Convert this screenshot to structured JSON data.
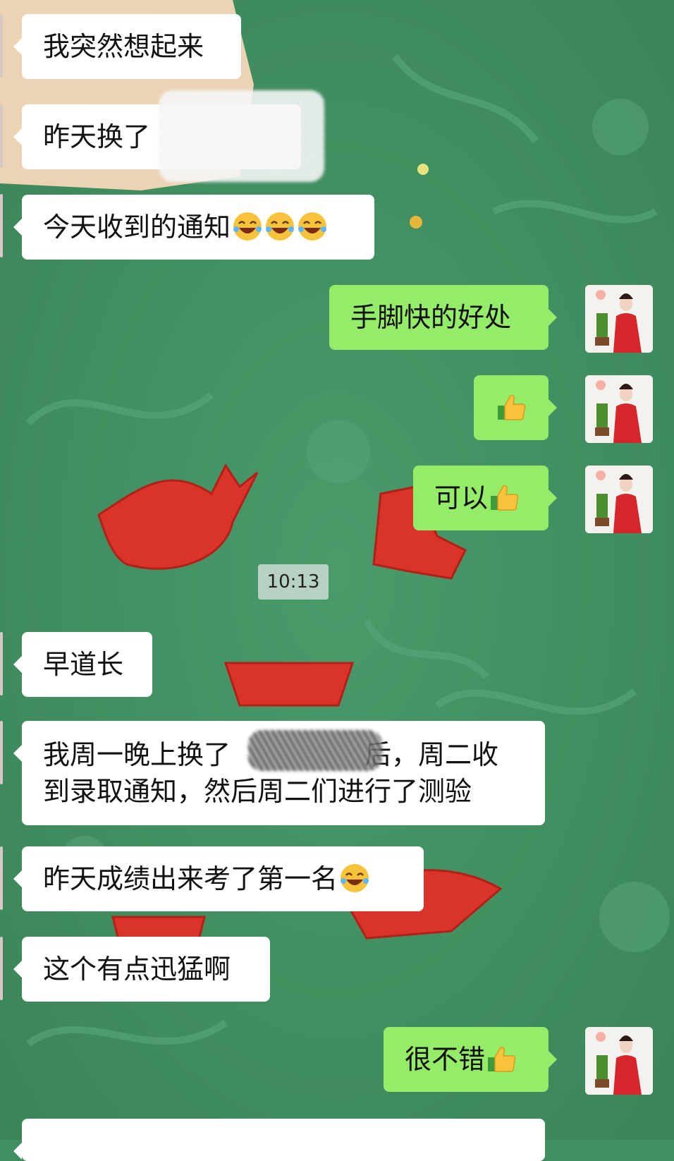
{
  "chat": {
    "messages": [
      {
        "side": "in",
        "text": "我突然想起来"
      },
      {
        "side": "in",
        "text": "昨天换了"
      },
      {
        "side": "in",
        "text": "今天收到的通知",
        "emoji": [
          "laugh-cry-emoji",
          "laugh-cry-emoji",
          "laugh-cry-emoji"
        ]
      },
      {
        "side": "out",
        "text": "手脚快的好处"
      },
      {
        "side": "out",
        "text": "",
        "emoji": [
          "thumbs-up-emoji"
        ]
      },
      {
        "side": "out",
        "text": "可以",
        "emoji": [
          "thumbs-up-emoji"
        ]
      },
      {
        "side": "in",
        "text": "早道长"
      },
      {
        "side": "in",
        "lines": [
          "我周一晚上换了",
          "后，周二收",
          "到录取通知，然后周二们进行了测验"
        ]
      },
      {
        "side": "in",
        "text": "昨天成绩出来考了第一名",
        "emoji": [
          "laugh-cry-emoji"
        ]
      },
      {
        "side": "in",
        "text": "这个有点迅猛啊"
      },
      {
        "side": "out",
        "text": "很不错",
        "emoji": [
          "thumbs-up-emoji"
        ]
      }
    ],
    "timestamp": "10:13"
  },
  "colors": {
    "background": "#3f8f60",
    "incoming_bubble": "#ffffff",
    "outgoing_bubble": "#95ec69",
    "emoji_yellow": "#f7c33a"
  }
}
